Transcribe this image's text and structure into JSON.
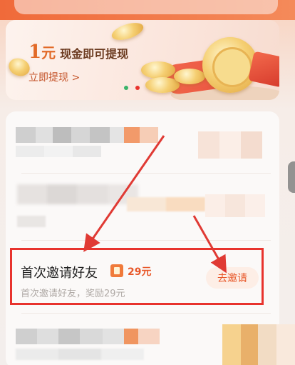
{
  "banner": {
    "amount": "1",
    "amount_unit": "元",
    "subtitle": "现金即可提现",
    "link": "立即提现 >"
  },
  "task": {
    "title": "首次邀请好友",
    "reward": "29元",
    "description": "首次邀请好友，奖励29元",
    "button_label": "去邀请"
  },
  "colors": {
    "accent": "#e8582a",
    "highlight_border": "#e8332d",
    "arrow": "#e03a34"
  },
  "icons": {
    "reward_badge": "coupon-icon",
    "side_tab": "side-handle-icon"
  }
}
